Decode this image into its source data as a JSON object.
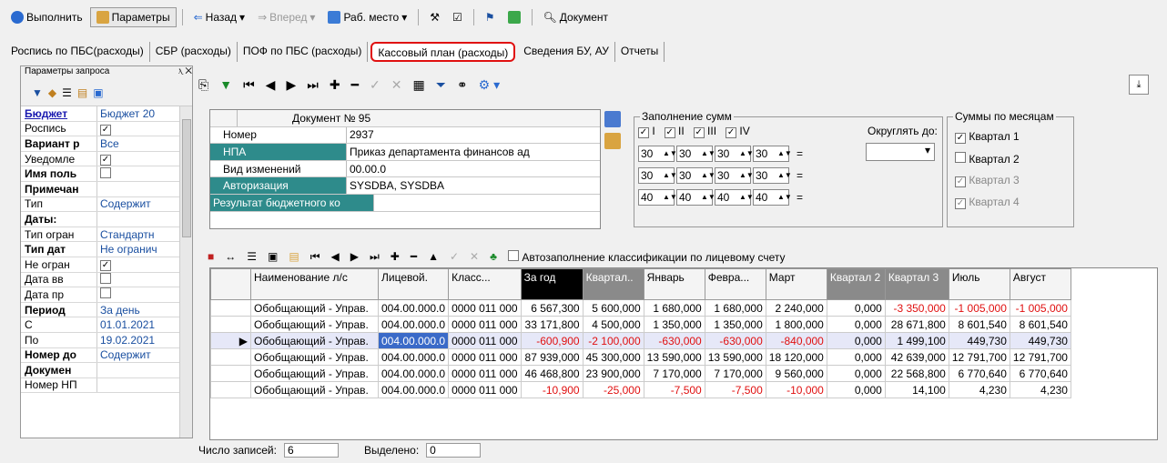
{
  "toolbar": {
    "run": "Выполнить",
    "params": "Параметры",
    "back": "Назад",
    "forward": "Вперед",
    "workplace": "Раб. место",
    "document": "Документ"
  },
  "tabs": [
    "Роспись по ПБС(расходы)",
    "СБР (расходы)",
    "ПОФ по ПБС (расходы)",
    "Кассовый план (расходы)",
    "Сведения БУ, АУ",
    "Отчеты"
  ],
  "active_tab": 3,
  "params_panel": {
    "title": "Параметры запроса",
    "rows": [
      {
        "k": "Бюджет",
        "v": "Бюджет 20"
      },
      {
        "k": "Роспись",
        "v": "✓"
      },
      {
        "k": "Вариант р",
        "v": "Все"
      },
      {
        "k": "Уведомле",
        "v": "✓"
      },
      {
        "k": "Имя поль",
        "v": ""
      },
      {
        "k": "Примечан",
        "v": ""
      },
      {
        "k": "Тип",
        "v": "Содержит"
      },
      {
        "k": "Даты:",
        "v": ""
      },
      {
        "k": "Тип огран",
        "v": "Стандартн"
      },
      {
        "k": "Тип дат",
        "v": "Не огранич"
      },
      {
        "k": "Не огран",
        "v": "✓"
      },
      {
        "k": "Дата вв",
        "v": ""
      },
      {
        "k": "Дата пр",
        "v": ""
      },
      {
        "k": "Период",
        "v": "За день"
      },
      {
        "k": "С",
        "v": "01.01.2021"
      },
      {
        "k": "По",
        "v": "19.02.2021"
      },
      {
        "k": "Номер до",
        "v": "Содержит"
      },
      {
        "k": "Докумен",
        "v": ""
      },
      {
        "k": "Номер НП",
        "v": ""
      }
    ]
  },
  "doc": {
    "header": "Документ № 95",
    "rows": [
      {
        "k": "Номер",
        "v": "2937"
      },
      {
        "k": "НПА",
        "v": "Приказ департамента финансов ад"
      },
      {
        "k": "Вид изменений",
        "v": "00.00.0"
      },
      {
        "k": "Авторизация",
        "v": "SYSDBA, SYSDBA"
      },
      {
        "k": "Результат бюджетного ко",
        "v": ""
      }
    ]
  },
  "fill": {
    "legend": "Заполнение сумм",
    "checks": [
      "I",
      "II",
      "III",
      "IV"
    ],
    "round_label": "Округлять до:",
    "rows": [
      [
        "30",
        "30",
        "30",
        "30"
      ],
      [
        "30",
        "30",
        "30",
        "30"
      ],
      [
        "40",
        "40",
        "40",
        "40"
      ]
    ]
  },
  "months": {
    "legend": "Суммы по месяцам",
    "items": [
      "Квартал 1",
      "Квартал 2",
      "Квартал 3",
      "Квартал 4"
    ]
  },
  "autofill": "Автозаполнение классификации по лицевому счету",
  "grid": {
    "columns": [
      "Наименование л/с",
      "Лицевой.",
      "Класс...",
      "За год",
      "Квартал..",
      "Январь",
      "Февра...",
      "Март",
      "Квартал 2",
      "Квартал 3",
      "Июль",
      "Август"
    ],
    "rows": [
      [
        "Обобщающий - Управ.",
        "004.00.000.0",
        "0000 011 000",
        "6 567,300",
        "5 600,000",
        "1 680,000",
        "1 680,000",
        "2 240,000",
        "0,000",
        "-3 350,000",
        "-1 005,000",
        "-1 005,000"
      ],
      [
        "Обобщающий - Управ.",
        "004.00.000.0",
        "0000 011 000",
        "33 171,800",
        "4 500,000",
        "1 350,000",
        "1 350,000",
        "1 800,000",
        "0,000",
        "28 671,800",
        "8 601,540",
        "8 601,540"
      ],
      [
        "Обобщающий - Управ.",
        "004.00.000.0",
        "0000 011 000",
        "-600,900",
        "-2 100,000",
        "-630,000",
        "-630,000",
        "-840,000",
        "0,000",
        "1 499,100",
        "449,730",
        "449,730"
      ],
      [
        "Обобщающий - Управ.",
        "004.00.000.0",
        "0000 011 000",
        "87 939,000",
        "45 300,000",
        "13 590,000",
        "13 590,000",
        "18 120,000",
        "0,000",
        "42 639,000",
        "12 791,700",
        "12 791,700"
      ],
      [
        "Обобщающий - Управ.",
        "004.00.000.0",
        "0000 011 000",
        "46 468,800",
        "23 900,000",
        "7 170,000",
        "7 170,000",
        "9 560,000",
        "0,000",
        "22 568,800",
        "6 770,640",
        "6 770,640"
      ],
      [
        "Обобщающий - Управ.",
        "004.00.000.0",
        "0000 011 000",
        "-10,900",
        "-25,000",
        "-7,500",
        "-7,500",
        "-10,000",
        "0,000",
        "14,100",
        "4,230",
        "4,230"
      ]
    ]
  },
  "status": {
    "count_label": "Число записей:",
    "count": "6",
    "sel_label": "Выделено:",
    "sel": "0"
  }
}
